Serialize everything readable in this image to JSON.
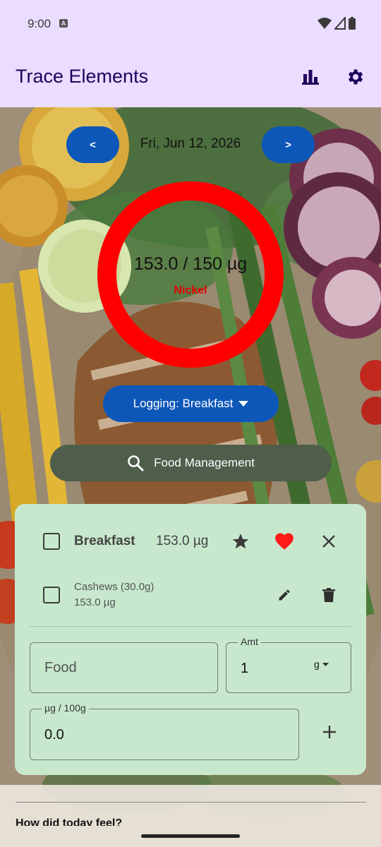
{
  "status_bar": {
    "time": "9:00"
  },
  "app_bar": {
    "title": "Trace Elements",
    "chart_icon": "bar-chart-icon",
    "settings_icon": "gear-icon"
  },
  "date_nav": {
    "prev_label": "<",
    "next_label": ">",
    "date": "Fri, Jun 12, 2026"
  },
  "progress": {
    "value_text": "153.0 / 150 µg",
    "element": "Nickel",
    "consumed": 153.0,
    "goal": 150,
    "ring_color": "#ff0000"
  },
  "logging": {
    "label": "Logging: Breakfast"
  },
  "food_management": {
    "label": "Food Management"
  },
  "meal": {
    "name": "Breakfast",
    "amount": "153.0 µg",
    "items": [
      {
        "name": "Cashews (30.0g)",
        "amount": "153.0 µg"
      }
    ]
  },
  "form": {
    "food_placeholder": "Food",
    "amt_label": "Amt",
    "amt_value": "1",
    "unit": "g",
    "per100_label": "µg / 100g",
    "per100_value": "0.0"
  },
  "footer": {
    "question": "How did today feel?"
  },
  "colors": {
    "header": "#eaddff",
    "primary_button": "#0d57b8",
    "secondary_button": "#4f5e4b",
    "card": "#c7e8cd",
    "heart": "#ff1a1a"
  }
}
